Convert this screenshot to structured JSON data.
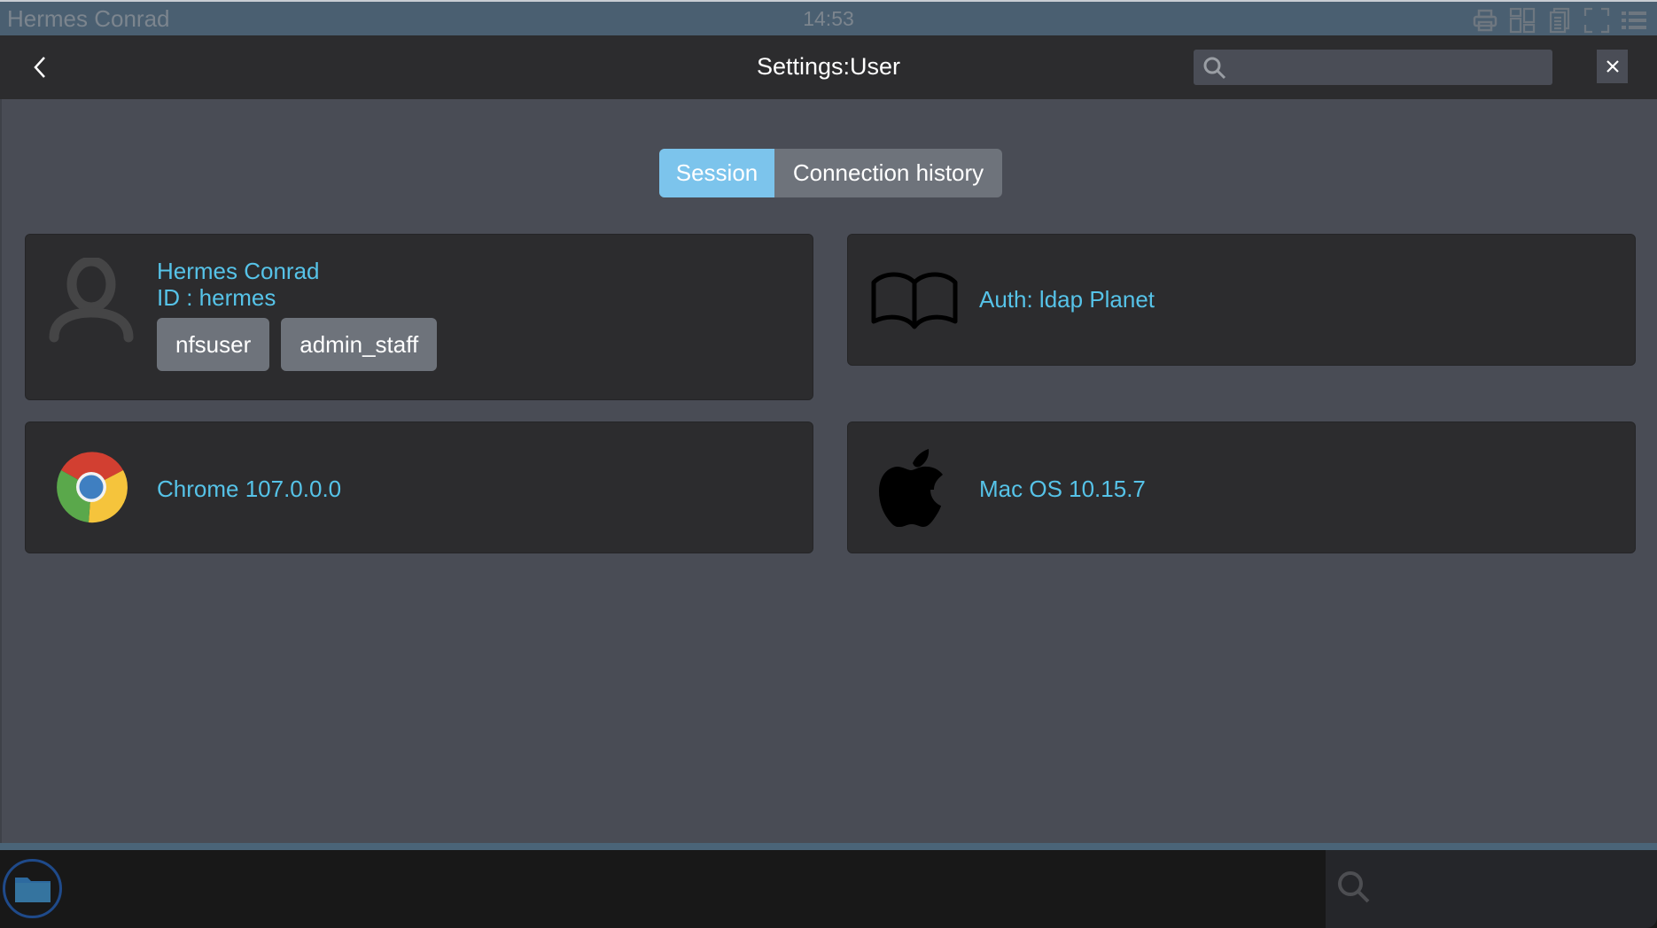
{
  "window": {
    "user_name": "Hermes Conrad",
    "clock": "14:53",
    "icons": [
      "printer-icon",
      "layout-icon",
      "documents-icon",
      "fullscreen-icon",
      "list-icon"
    ]
  },
  "header": {
    "back_icon": "chevron-left-icon",
    "title": "Settings:User",
    "search": {
      "placeholder": "",
      "value": "",
      "icon": "search-icon"
    },
    "close_icon": "close-icon"
  },
  "tabs": [
    {
      "label": "Session",
      "active": true
    },
    {
      "label": "Connection history",
      "active": false
    }
  ],
  "cards": {
    "user": {
      "icon": "user-icon",
      "name": "Hermes Conrad",
      "id_line": "ID : hermes",
      "groups": [
        "nfsuser",
        "admin_staff"
      ]
    },
    "auth": {
      "icon": "book-icon",
      "text": "Auth: ldap Planet"
    },
    "browser": {
      "icon": "chrome-icon",
      "text": "Chrome 107.0.0.0"
    },
    "os": {
      "icon": "apple-icon",
      "text": "Mac OS 10.15.7"
    }
  },
  "taskbar": {
    "folder_icon": "folder-icon",
    "search_icon": "search-icon"
  },
  "colors": {
    "accent_text": "#56c3e8",
    "active_tab": "#7cc4ec",
    "card_bg": "#2c2c2e",
    "main_bg": "#494c55"
  }
}
